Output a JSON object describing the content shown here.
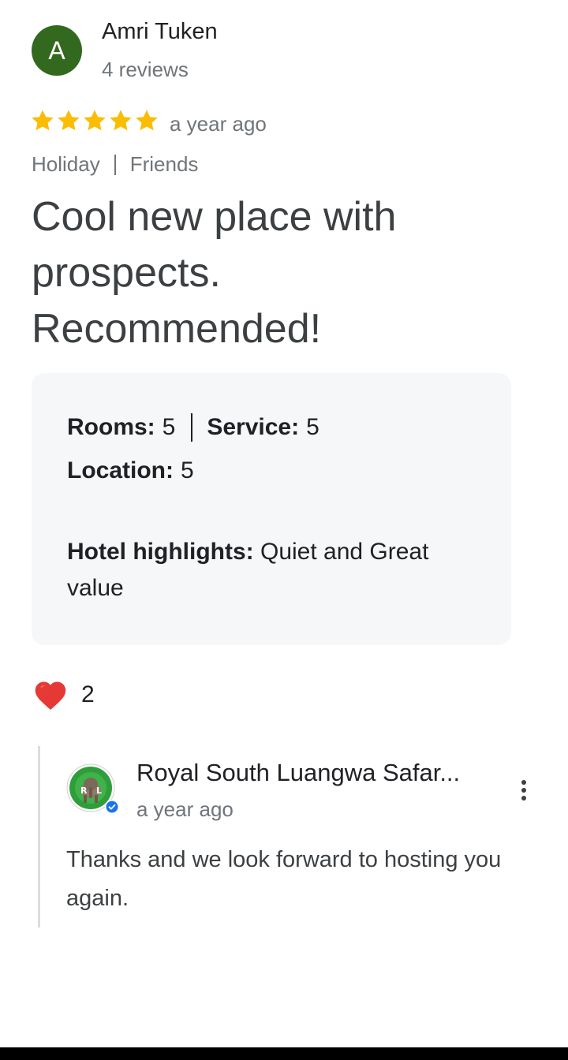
{
  "reviewer": {
    "initial": "A",
    "name": "Amri Tuken",
    "review_count": "4 reviews",
    "avatar_color": "#33691e"
  },
  "review": {
    "stars": 5,
    "max_stars": 5,
    "star_color": "#fbbc04",
    "time": "a year ago",
    "tags": [
      "Holiday",
      "Friends"
    ],
    "title": "Cool new place with prospects. Recommended!"
  },
  "ratings": {
    "rooms_label": "Rooms:",
    "rooms_value": "5",
    "service_label": "Service:",
    "service_value": "5",
    "location_label": "Location:",
    "location_value": "5",
    "highlights_label": "Hotel highlights:",
    "highlights_value": "Quiet and Great value"
  },
  "reactions": {
    "icon": "heart-icon",
    "count": "2"
  },
  "owner_reply": {
    "name": "Royal South Luangwa Safar...",
    "time": "a year ago",
    "text": "Thanks and we look forward to hosting you again.",
    "verified_color": "#1a73e8",
    "menu_icon": "more-vert-icon"
  }
}
